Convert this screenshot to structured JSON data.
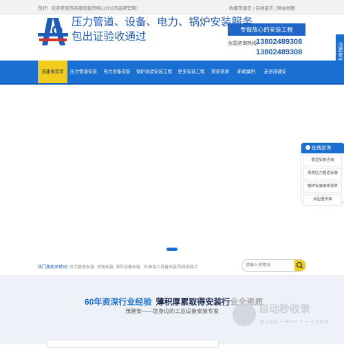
{
  "topbar": {
    "welcome": "您好！欢迎来到茂名建筑集团佛山分公司品牌官网！",
    "links": [
      "收藏茂建安",
      "在线留言",
      "网站地图"
    ]
  },
  "header": {
    "slogan_line1": "压力管道、设备、电力、锅炉安装服务",
    "slogan_line2": "包出证验收通过",
    "pill": "专做放心的安装工程",
    "hotline_label": "全国咨询热线:",
    "phone1": "13802489308",
    "phone2": "13802489308"
  },
  "nav": {
    "items": [
      "茂建省首页",
      "压力管道安装",
      "电力设备安装",
      "锅炉改造安装工程",
      "更多安装工程",
      "荣誉资质",
      "新闻案例",
      "走进茂建安"
    ],
    "active_index": 0
  },
  "sidetab": "茂建安在线客服",
  "online": {
    "title": "在线咨询",
    "items": [
      "管道安装咨询",
      "燕窝压力管道安装",
      "锅炉安装维修保养",
      "反应釜安装"
    ]
  },
  "keywords": {
    "label": "热门搜索关键词：",
    "items": [
      "压力管道安装",
      "机电安装",
      "消防设备安装",
      "石油化工设备安装",
      "防腐安装工"
    ]
  },
  "search": {
    "placeholder": "请输入关键词"
  },
  "section": {
    "title_a": "60年资深行业经验",
    "title_b": "薄积厚累取得安装行",
    "title_c": "业全资质",
    "subtitle": "茂建安——您身边的工业设备安装专家"
  },
  "watermark": {
    "title": "自动秒收录",
    "subtitle": "放上链接 一 来访一下 一 自动收录"
  },
  "colors": {
    "primary": "#1a6fd3",
    "accent": "#f2cc1a",
    "brand_text": "#1f5cb8"
  }
}
